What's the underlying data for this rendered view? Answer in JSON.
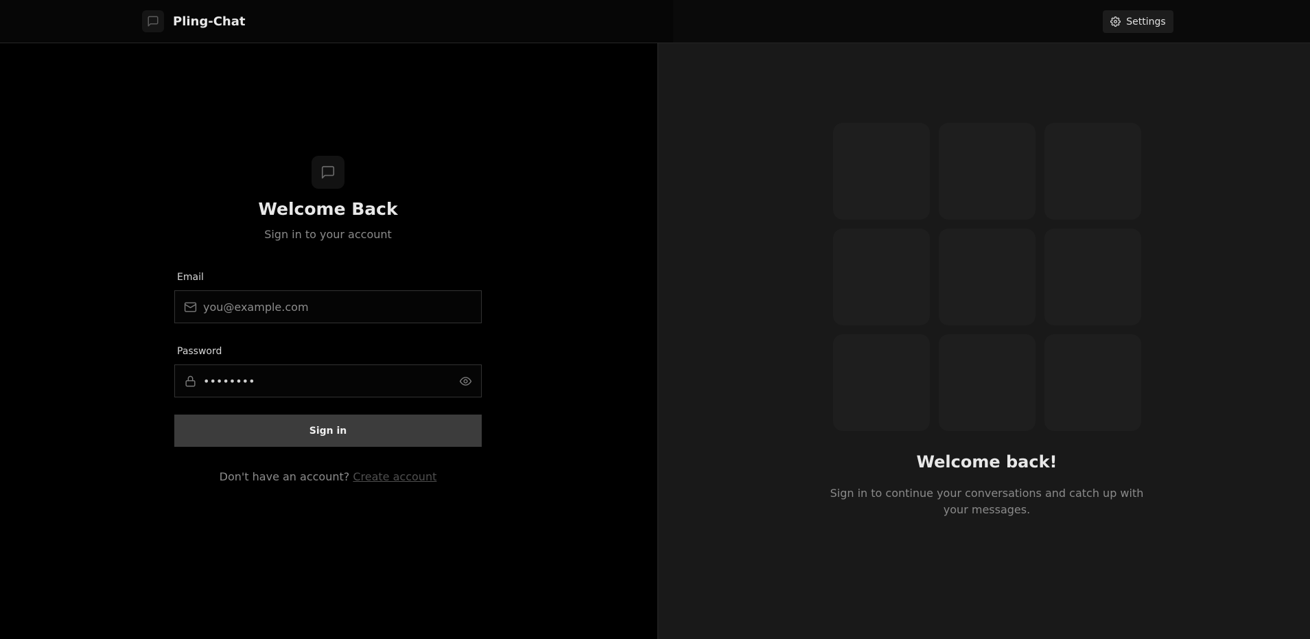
{
  "header": {
    "app_name": "Pling-Chat",
    "settings_label": "Settings"
  },
  "login": {
    "title": "Welcome Back",
    "subtitle": "Sign in to your account",
    "email_label": "Email",
    "email_placeholder": "you@example.com",
    "email_value": "",
    "password_label": "Password",
    "password_value": "password",
    "signin_label": "Sign in",
    "no_account_text": "Don't have an account?",
    "create_account_link": "Create account"
  },
  "promo": {
    "title": "Welcome back!",
    "subtitle": "Sign in to continue your conversations and catch up with your messages.",
    "tile_count": 9
  },
  "icons": {
    "brand": "chat-bubble-icon",
    "settings": "gear-icon",
    "email": "mail-icon",
    "password": "lock-icon",
    "toggle_password": "eye-icon"
  },
  "colors": {
    "background": "#000000",
    "panel_right": "#191919",
    "button": "#3c3c3c",
    "muted_text": "#8a8a8a"
  }
}
